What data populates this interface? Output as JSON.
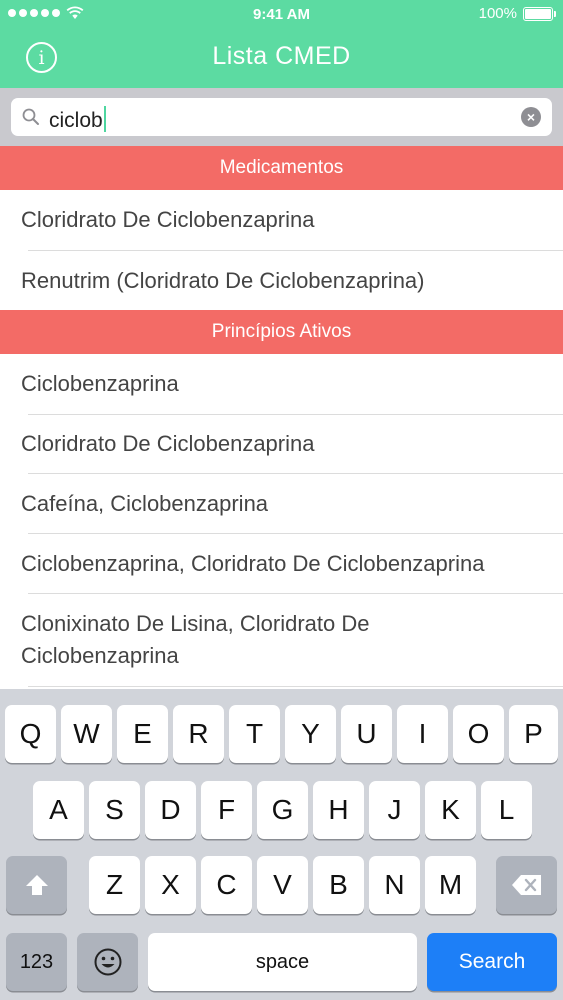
{
  "status_bar": {
    "time": "9:41 AM",
    "battery": "100%"
  },
  "header": {
    "title": "Lista CMED",
    "info_icon": "info-icon"
  },
  "search": {
    "query": "ciclob",
    "search_icon": "search-icon",
    "clear_icon": "clear-icon"
  },
  "sections": [
    {
      "title": "Medicamentos",
      "items": [
        "Cloridrato De Ciclobenzaprina",
        "Renutrim (Cloridrato De Ciclobenzaprina)"
      ]
    },
    {
      "title": "Princípios Ativos",
      "items": [
        "Ciclobenzaprina",
        "Cloridrato De Ciclobenzaprina",
        "Cafeína, Ciclobenzaprina",
        "Ciclobenzaprina, Cloridrato De Ciclobenzaprina",
        "Clonixinato De Lisina, Cloridrato De Ciclobenzaprina"
      ]
    }
  ],
  "keyboard": {
    "row1": [
      "Q",
      "W",
      "E",
      "R",
      "T",
      "Y",
      "U",
      "I",
      "O",
      "P"
    ],
    "row2": [
      "A",
      "S",
      "D",
      "F",
      "G",
      "H",
      "J",
      "K",
      "L"
    ],
    "row3": [
      "Z",
      "X",
      "C",
      "V",
      "B",
      "N",
      "M"
    ],
    "numbers_label": "123",
    "space_label": "space",
    "search_label": "Search",
    "shift_icon": "shift-icon",
    "delete_icon": "delete-icon",
    "emoji_icon": "emoji-icon"
  },
  "colors": {
    "header": "#5cdba2",
    "section_header": "#f36b66",
    "search_key": "#1d7ff7"
  }
}
